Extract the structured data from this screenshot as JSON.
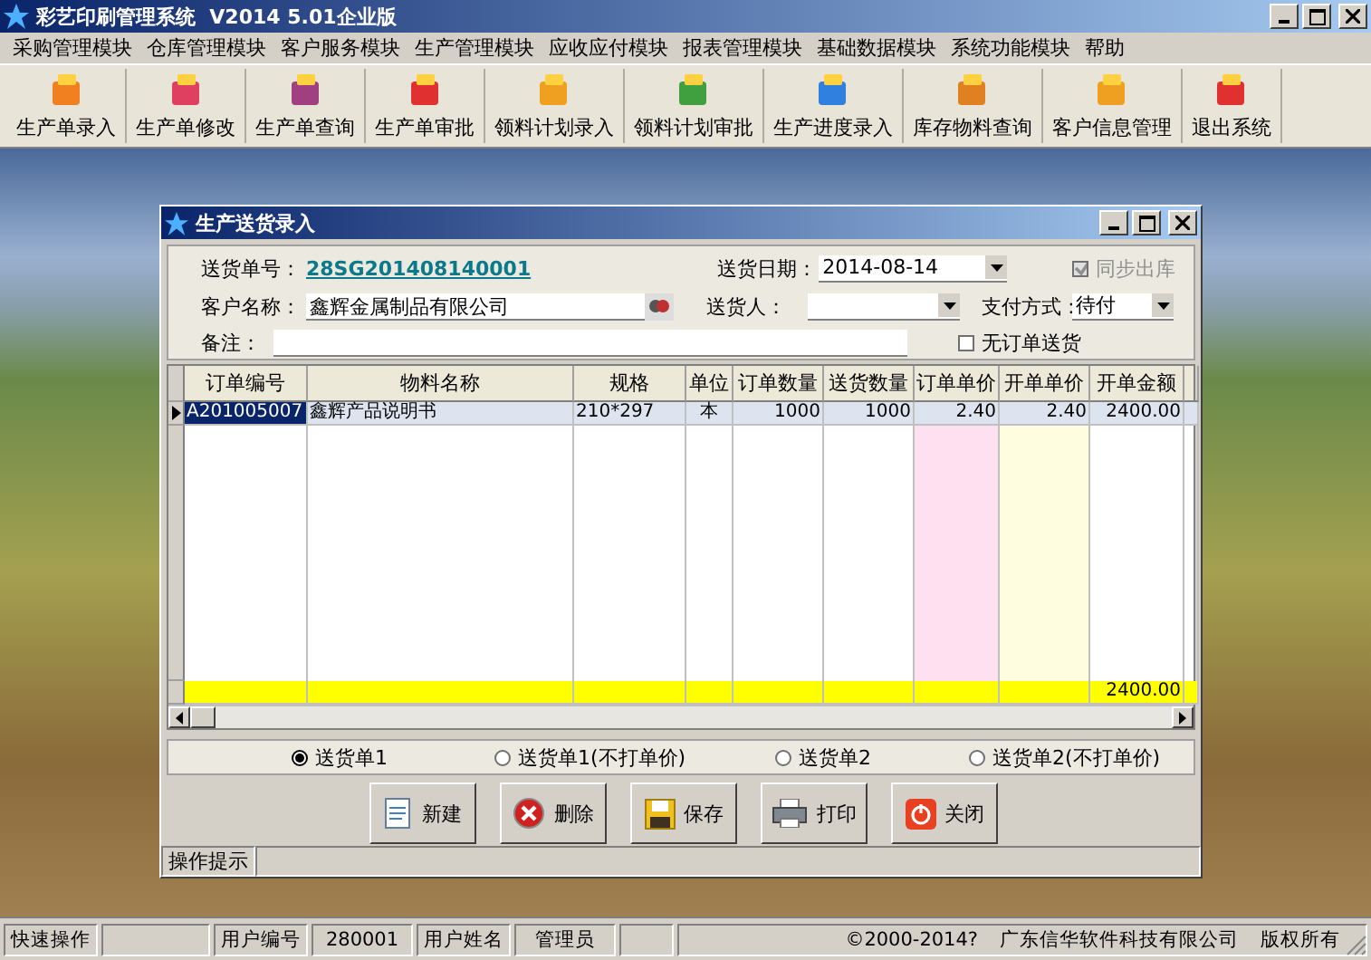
{
  "window": {
    "title": "彩艺印刷管理系统  V2014 5.01企业版"
  },
  "menu": [
    "采购管理模块",
    "仓库管理模块",
    "客户服务模块",
    "生产管理模块",
    "应收应付模块",
    "报表管理模块",
    "基础数据模块",
    "系统功能模块",
    "帮助"
  ],
  "toolbar": [
    "生产单录入",
    "生产单修改",
    "生产单查询",
    "生产单审批",
    "领料计划录入",
    "领料计划审批",
    "生产进度录入",
    "库存物料查询",
    "客户信息管理",
    "退出系统"
  ],
  "dialog": {
    "title": "生产送货录入",
    "form": {
      "delivery_no": {
        "label": "送货单号：",
        "value": "28SG201408140001"
      },
      "date": {
        "label": "送货日期：",
        "value": "2014-08-14"
      },
      "sync": {
        "label": "同步出库",
        "checked": true,
        "disabled": true
      },
      "customer": {
        "label": "客户名称：",
        "value": "鑫辉金属制品有限公司"
      },
      "deliverer": {
        "label": "送货人："
      },
      "payment": {
        "label": "支付方式：",
        "value": "待付"
      },
      "remark": {
        "label": "备注："
      },
      "no_order": {
        "label": "无订单送货",
        "checked": false,
        "disabled": false
      }
    },
    "table": {
      "columns": [
        "订单编号",
        "物料名称",
        "规格",
        "单位",
        "订单数量",
        "送货数量",
        "订单单价",
        "开单单价",
        "开单金额"
      ],
      "rows": [
        {
          "selected": true,
          "cells": [
            "A201005007",
            "鑫辉产品说明书",
            "210*297",
            "本",
            "1000",
            "1000",
            "2.40",
            "2.40",
            "2400.00"
          ]
        }
      ],
      "totals": {
        "amount": "2400.00"
      }
    },
    "radios": [
      {
        "label": "送货单1",
        "selected": true
      },
      {
        "label": "送货单1(不打单价)",
        "selected": false
      },
      {
        "label": "送货单2",
        "selected": false
      },
      {
        "label": "送货单2(不打单价)",
        "selected": false
      }
    ],
    "buttons": [
      "新建",
      "删除",
      "保存",
      "打印",
      "关闭"
    ],
    "hint": "操作提示"
  },
  "status_bar": {
    "quick": "快速操作",
    "fields": [
      {
        "label": "用户编号",
        "value": "280001"
      },
      {
        "label": "用户姓名",
        "value": "管理员"
      }
    ],
    "copyright": "©2000-2014?",
    "company": "广东信华软件科技有限公司",
    "rights": "版权所有"
  }
}
